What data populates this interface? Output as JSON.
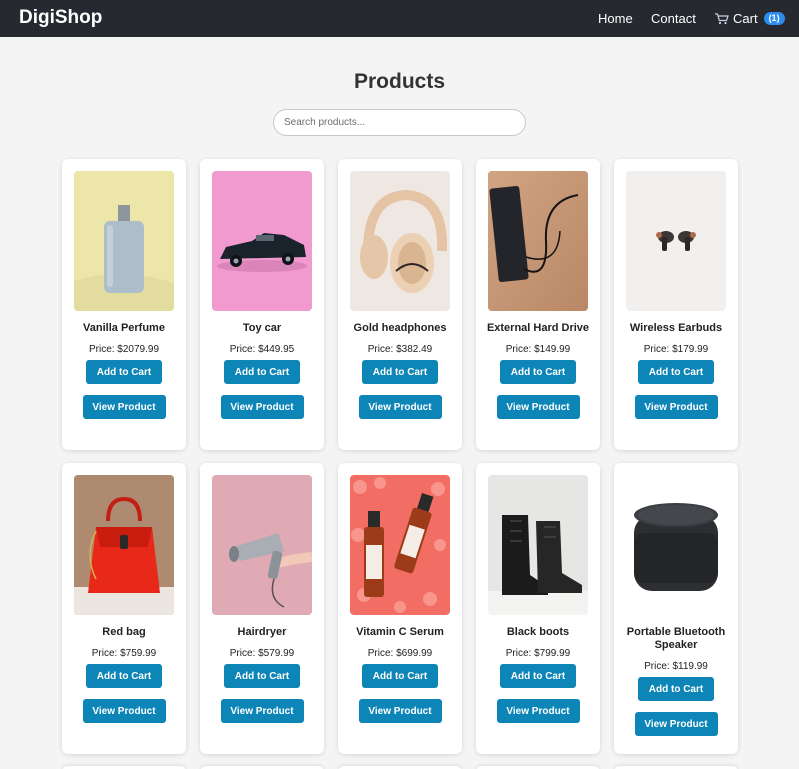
{
  "navbar": {
    "brand": "DigiShop",
    "home": "Home",
    "contact": "Contact",
    "cart_label": "Cart",
    "cart_count": "(1)"
  },
  "page": {
    "title": "Products",
    "search_placeholder": "Search products..."
  },
  "labels": {
    "add_to_cart": "Add to Cart",
    "view_product": "View Product"
  },
  "products": [
    {
      "name": "Vanilla Perfume",
      "price": "Price: $2079.99",
      "image": "perfume-bottle"
    },
    {
      "name": "Toy car",
      "price": "Price: $449.95",
      "image": "toy-car"
    },
    {
      "name": "Gold headphones",
      "price": "Price: $382.49",
      "image": "headphones"
    },
    {
      "name": "External Hard Drive",
      "price": "Price: $149.99",
      "image": "hard-drive"
    },
    {
      "name": "Wireless Earbuds",
      "price": "Price: $179.99",
      "image": "earbuds"
    },
    {
      "name": "Red bag",
      "price": "Price: $759.99",
      "image": "red-bag"
    },
    {
      "name": "Hairdryer",
      "price": "Price: $579.99",
      "image": "hairdryer"
    },
    {
      "name": "Vitamin C Serum",
      "price": "Price: $699.99",
      "image": "serum-bottles"
    },
    {
      "name": "Black boots",
      "price": "Price: $799.99",
      "image": "boots"
    },
    {
      "name": "Portable Bluetooth Speaker",
      "price": "Price: $119.99",
      "image": "speaker"
    }
  ],
  "colors": {
    "navbar": "#262930",
    "button": "#0d86b7",
    "badge": "#2d8cf0",
    "background": "#f4f4f4"
  }
}
